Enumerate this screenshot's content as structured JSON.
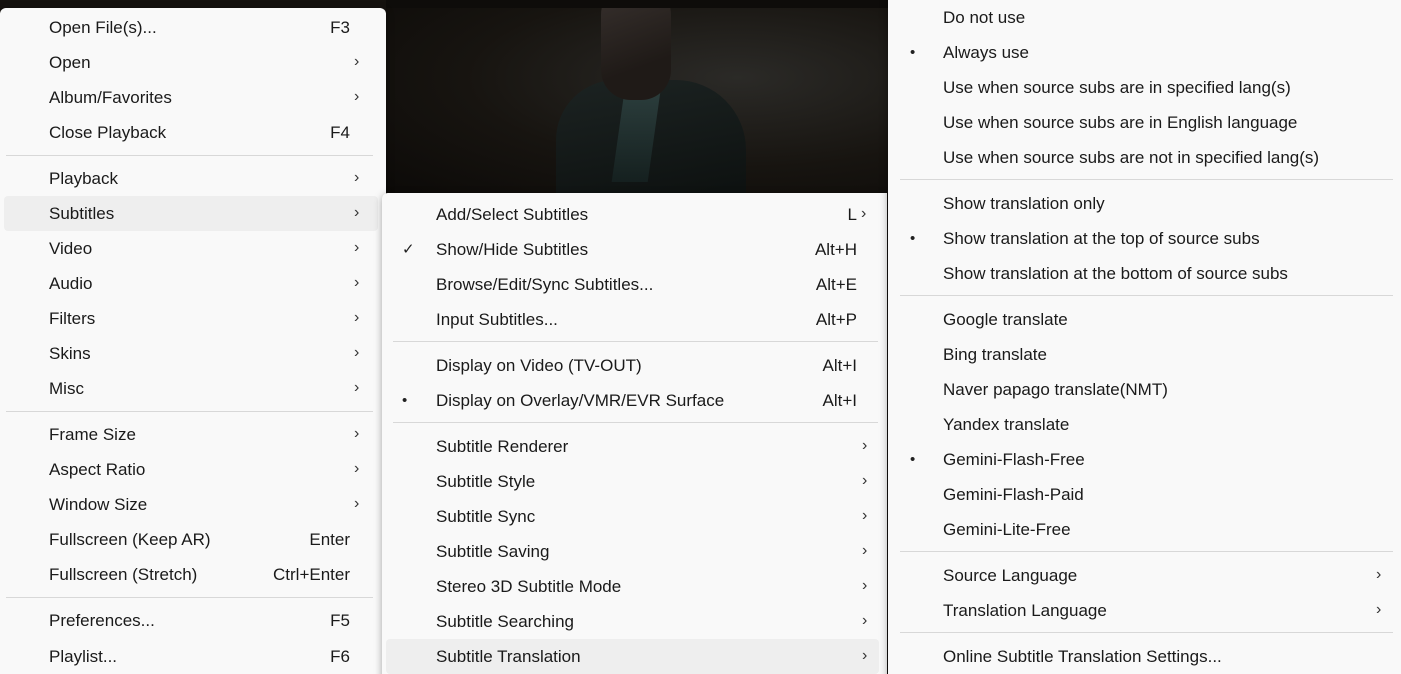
{
  "main_menu": {
    "items": [
      {
        "label": "Open File(s)...",
        "shortcut": "F3"
      },
      {
        "label": "Open",
        "arrow": "›"
      },
      {
        "label": "Album/Favorites",
        "arrow": "›"
      },
      {
        "label": "Close Playback",
        "shortcut": "F4"
      },
      {
        "label": "Playback",
        "arrow": "›"
      },
      {
        "label": "Subtitles",
        "arrow": "›"
      },
      {
        "label": "Video",
        "arrow": "›"
      },
      {
        "label": "Audio",
        "arrow": "›"
      },
      {
        "label": "Filters",
        "arrow": "›"
      },
      {
        "label": "Skins",
        "arrow": "›"
      },
      {
        "label": "Misc",
        "arrow": "›"
      },
      {
        "label": "Frame Size",
        "arrow": "›"
      },
      {
        "label": "Aspect Ratio",
        "arrow": "›"
      },
      {
        "label": "Window Size",
        "arrow": "›"
      },
      {
        "label": "Fullscreen (Keep AR)",
        "shortcut": "Enter"
      },
      {
        "label": "Fullscreen (Stretch)",
        "shortcut": "Ctrl+Enter"
      },
      {
        "label": "Preferences...",
        "shortcut": "F5"
      },
      {
        "label": "Playlist...",
        "shortcut": "F6"
      }
    ]
  },
  "subtitles_menu": {
    "items": [
      {
        "label": "Add/Select Subtitles",
        "shortcut": "L",
        "arrow": "›"
      },
      {
        "label": "Show/Hide Subtitles",
        "shortcut": "Alt+H",
        "mark": "✓"
      },
      {
        "label": "Browse/Edit/Sync Subtitles...",
        "shortcut": "Alt+E"
      },
      {
        "label": "Input Subtitles...",
        "shortcut": "Alt+P"
      },
      {
        "label": "Display on Video (TV-OUT)",
        "shortcut": "Alt+I"
      },
      {
        "label": "Display on Overlay/VMR/EVR Surface",
        "shortcut": "Alt+I",
        "mark": "•"
      },
      {
        "label": "Subtitle Renderer",
        "arrow": "›"
      },
      {
        "label": "Subtitle Style",
        "arrow": "›"
      },
      {
        "label": "Subtitle Sync",
        "arrow": "›"
      },
      {
        "label": "Subtitle Saving",
        "arrow": "›"
      },
      {
        "label": "Stereo 3D Subtitle Mode",
        "arrow": "›"
      },
      {
        "label": "Subtitle Searching",
        "arrow": "›"
      },
      {
        "label": "Subtitle Translation",
        "arrow": "›"
      }
    ]
  },
  "translation_menu": {
    "items": [
      {
        "label": "Do not use"
      },
      {
        "label": "Always use",
        "mark": "•"
      },
      {
        "label": "Use when source subs are in specified lang(s)"
      },
      {
        "label": "Use when source subs are in English language"
      },
      {
        "label": "Use when source subs are not in specified lang(s)"
      },
      {
        "label": "Show translation only"
      },
      {
        "label": "Show translation at the top of source subs",
        "mark": "•"
      },
      {
        "label": "Show translation at the bottom of source subs"
      },
      {
        "label": "Google translate"
      },
      {
        "label": "Bing translate"
      },
      {
        "label": "Naver papago translate(NMT)"
      },
      {
        "label": "Yandex translate"
      },
      {
        "label": "Gemini-Flash-Free",
        "mark": "•"
      },
      {
        "label": "Gemini-Flash-Paid"
      },
      {
        "label": "Gemini-Lite-Free"
      },
      {
        "label": "Source Language",
        "arrow": "›"
      },
      {
        "label": "Translation Language",
        "arrow": "›"
      },
      {
        "label": "Online Subtitle Translation Settings..."
      }
    ]
  }
}
